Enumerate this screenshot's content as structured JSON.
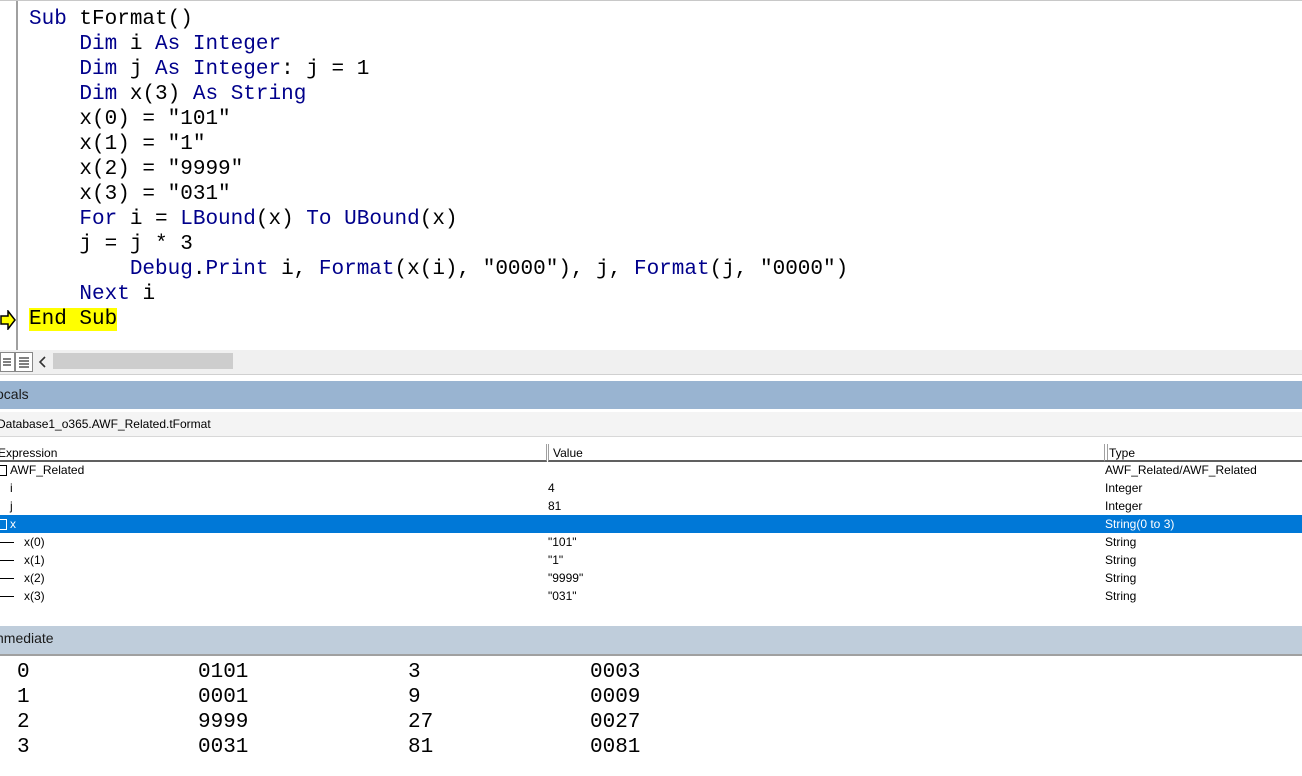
{
  "editor": {
    "lines": [
      {
        "indent": "",
        "parts": [
          {
            "t": "Sub",
            "k": true
          },
          {
            "t": " tFormat()",
            "k": false
          }
        ]
      },
      {
        "indent": "    ",
        "parts": [
          {
            "t": "Dim",
            "k": true
          },
          {
            "t": " i ",
            "k": false
          },
          {
            "t": "As",
            "k": true
          },
          {
            "t": " ",
            "k": false
          },
          {
            "t": "Integer",
            "k": true
          }
        ]
      },
      {
        "indent": "    ",
        "parts": [
          {
            "t": "Dim",
            "k": true
          },
          {
            "t": " j ",
            "k": false
          },
          {
            "t": "As",
            "k": true
          },
          {
            "t": " ",
            "k": false
          },
          {
            "t": "Integer",
            "k": true
          },
          {
            "t": ": j = 1",
            "k": false
          }
        ]
      },
      {
        "indent": "    ",
        "parts": [
          {
            "t": "Dim",
            "k": true
          },
          {
            "t": " x(3) ",
            "k": false
          },
          {
            "t": "As",
            "k": true
          },
          {
            "t": " ",
            "k": false
          },
          {
            "t": "String",
            "k": true
          }
        ]
      },
      {
        "indent": "    ",
        "parts": [
          {
            "t": "x(0) = \"101\"",
            "k": false
          }
        ]
      },
      {
        "indent": "    ",
        "parts": [
          {
            "t": "x(1) = \"1\"",
            "k": false
          }
        ]
      },
      {
        "indent": "    ",
        "parts": [
          {
            "t": "x(2) = \"9999\"",
            "k": false
          }
        ]
      },
      {
        "indent": "    ",
        "parts": [
          {
            "t": "x(3) = \"031\"",
            "k": false
          }
        ]
      },
      {
        "indent": "    ",
        "parts": [
          {
            "t": "For",
            "k": true
          },
          {
            "t": " i = ",
            "k": false
          },
          {
            "t": "LBound",
            "k": true
          },
          {
            "t": "(x) ",
            "k": false
          },
          {
            "t": "To",
            "k": true
          },
          {
            "t": " ",
            "k": false
          },
          {
            "t": "UBound",
            "k": true
          },
          {
            "t": "(x)",
            "k": false
          }
        ]
      },
      {
        "indent": "    ",
        "parts": [
          {
            "t": "j = j * 3",
            "k": false
          }
        ]
      },
      {
        "indent": "        ",
        "parts": [
          {
            "t": "Debug",
            "k": true
          },
          {
            "t": ".",
            "k": false
          },
          {
            "t": "Print",
            "k": true
          },
          {
            "t": " i, ",
            "k": false
          },
          {
            "t": "Format",
            "k": true
          },
          {
            "t": "(x(i), \"0000\"), j, ",
            "k": false
          },
          {
            "t": "Format",
            "k": true
          },
          {
            "t": "(j, \"0000\")",
            "k": false
          }
        ]
      },
      {
        "indent": "    ",
        "parts": [
          {
            "t": "Next",
            "k": true
          },
          {
            "t": " i",
            "k": false
          }
        ]
      },
      {
        "indent": "",
        "parts": [
          {
            "t": "End Sub",
            "k": false,
            "hl": true
          }
        ]
      }
    ]
  },
  "locals": {
    "title": "ocals",
    "context": "Database1_o365.AWF_Related.tFormat",
    "columns": {
      "expression": "Expression",
      "value": "Value",
      "type": "Type"
    },
    "rows": [
      {
        "expr": "AWF_Related",
        "value": "",
        "type": "AWF_Related/AWF_Related",
        "prefix": "box",
        "indent": 10,
        "selected": false
      },
      {
        "expr": "i",
        "value": "4",
        "type": "Integer",
        "prefix": "",
        "indent": 10,
        "selected": false
      },
      {
        "expr": "j",
        "value": "81",
        "type": "Integer",
        "prefix": "",
        "indent": 10,
        "selected": false
      },
      {
        "expr": "x",
        "value": "",
        "type": "String(0 to 3)",
        "prefix": "box",
        "indent": 10,
        "selected": true
      },
      {
        "expr": "x(0)",
        "value": "\"101\"",
        "type": "String",
        "prefix": "line",
        "indent": 24,
        "selected": false
      },
      {
        "expr": "x(1)",
        "value": "\"1\"",
        "type": "String",
        "prefix": "line",
        "indent": 24,
        "selected": false
      },
      {
        "expr": "x(2)",
        "value": "\"9999\"",
        "type": "String",
        "prefix": "line",
        "indent": 24,
        "selected": false
      },
      {
        "expr": "x(3)",
        "value": "\"031\"",
        "type": "String",
        "prefix": "line",
        "indent": 24,
        "selected": false
      }
    ]
  },
  "immediate": {
    "title": "nmediate",
    "rows": [
      [
        "0",
        "0101",
        "3",
        "0003"
      ],
      [
        "1",
        "0001",
        "9",
        "0009"
      ],
      [
        "2",
        "9999",
        "27",
        "0027"
      ],
      [
        "3",
        "0031",
        "81",
        "0081"
      ]
    ]
  },
  "icons": {
    "exec_arrow": "execution-arrow-icon",
    "procedure_view": "procedure-view-icon",
    "full_module_view": "full-module-view-icon",
    "scroll_left": "chevron-left-icon"
  },
  "colors": {
    "keyword": "#00008b",
    "highlight": "#ffff00",
    "selection": "#0078d7",
    "locals_title": "#99b4d1"
  }
}
